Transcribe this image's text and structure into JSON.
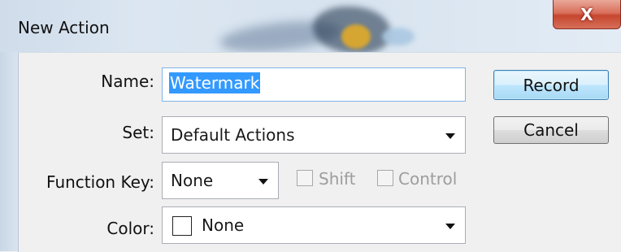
{
  "window": {
    "title": "New Action",
    "close_glyph": "X"
  },
  "form": {
    "name_label": "Name:",
    "name_value": "Watermark",
    "set_label": "Set:",
    "set_value": "Default Actions",
    "function_key_label": "Function Key:",
    "function_key_value": "None",
    "shift_label": "Shift",
    "shift_checked": false,
    "control_label": "Control",
    "control_checked": false,
    "color_label": "Color:",
    "color_value": "None",
    "color_swatch": "#ffffff"
  },
  "buttons": {
    "record_label": "Record",
    "cancel_label": "Cancel"
  },
  "icons": {
    "dropdown": "chevron-down-icon",
    "close": "close-icon"
  }
}
